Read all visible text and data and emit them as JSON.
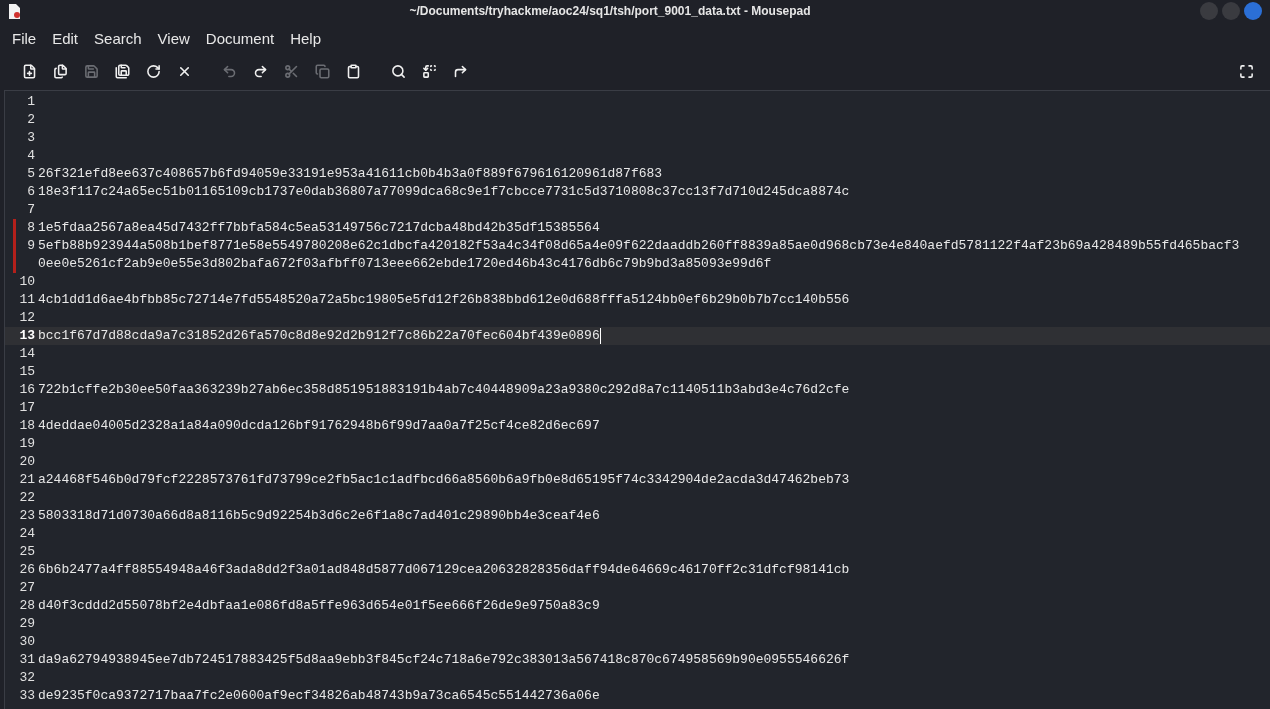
{
  "window": {
    "title": "~/Documents/tryhackme/aoc24/sq1/tsh/port_9001_data.txt - Mousepad"
  },
  "menu": [
    "File",
    "Edit",
    "Search",
    "View",
    "Document",
    "Help"
  ],
  "toolbar": [
    {
      "kind": "new",
      "disabled": false
    },
    {
      "kind": "new-window",
      "disabled": false
    },
    {
      "kind": "save",
      "disabled": true
    },
    {
      "kind": "save-as",
      "disabled": false
    },
    {
      "kind": "reload",
      "disabled": false
    },
    {
      "kind": "close",
      "disabled": false
    },
    {
      "kind": "undo",
      "disabled": true
    },
    {
      "kind": "redo",
      "disabled": false
    },
    {
      "kind": "cut",
      "disabled": true
    },
    {
      "kind": "copy",
      "disabled": true
    },
    {
      "kind": "paste",
      "disabled": false
    },
    {
      "kind": "find",
      "disabled": false
    },
    {
      "kind": "replace",
      "disabled": false
    },
    {
      "kind": "goto",
      "disabled": false
    },
    {
      "kind": "fullscreen",
      "disabled": false
    }
  ],
  "lines": [
    {
      "number": "1",
      "current": false,
      "modified": false
    },
    {
      "number": "2",
      "current": false,
      "modified": false
    },
    {
      "number": "3",
      "current": false,
      "modified": false
    },
    {
      "number": "4",
      "current": false,
      "modified": false
    },
    {
      "number": "5",
      "text": "26f321efd8ee637c408657b6fd94059e33191e953a41611cb0b4b3a0f889f679616120961d87f683",
      "current": false,
      "modified": false
    },
    {
      "number": "6",
      "text": "18e3f117c24a65ec51b01165109cb1737e0dab36807a77099dca68c9e1f7cbcce7731c5d3710808c37cc13f7d710d245dca8874c",
      "current": false,
      "modified": false
    },
    {
      "number": "7",
      "current": false,
      "modified": false
    },
    {
      "number": "8",
      "text": "1e5fdaa2567a8ea45d7432ff7bbfa584c5ea53149756c7217dcba48bd42b35df15385564",
      "current": false,
      "modified": true
    },
    {
      "number": "9",
      "text": "5efb88b923944a508b1bef8771e58e5549780208e62c1dbcfa420182f53a4c34f08d65a4e09f622daaddb260ff8839a85ae0d968cb73e4e840aefd5781122f4af23b69a428489b55fd465bacf30ee0e5261cf2ab9e0e55e3d802bafa672f03afbff0713eee662ebde1720ed46b43c4176db6c79b9bd3a85093e99d6f",
      "current": false,
      "modified": true
    },
    {
      "number": "10",
      "current": false,
      "modified": false
    },
    {
      "number": "11",
      "text": "4cb1dd1d6ae4bfbb85c72714e7fd5548520a72a5bc19805e5fd12f26b838bbd612e0d688fffa5124bb0ef6b29b0b7b7cc140b556",
      "current": false,
      "modified": false
    },
    {
      "number": "12",
      "current": false,
      "modified": false
    },
    {
      "number": "13",
      "text": "bcc1f67d7d88cda9a7c31852d26fa570c8d8e92d2b912f7c86b22a70fec604bf439e0896",
      "current": true,
      "modified": false
    },
    {
      "number": "14",
      "current": false,
      "modified": false
    },
    {
      "number": "15",
      "current": false,
      "modified": false
    },
    {
      "number": "16",
      "text": "722b1cffe2b30ee50faa363239b27ab6ec358d851951883191b4ab7c40448909a23a9380c292d8a7c1140511b3abd3e4c76d2cfe",
      "current": false,
      "modified": false
    },
    {
      "number": "17",
      "current": false,
      "modified": false
    },
    {
      "number": "18",
      "text": "4deddae04005d2328a1a84a090dcda126bf91762948b6f99d7aa0a7f25cf4ce82d6ec697",
      "current": false,
      "modified": false
    },
    {
      "number": "19",
      "current": false,
      "modified": false
    },
    {
      "number": "20",
      "current": false,
      "modified": false
    },
    {
      "number": "21",
      "text": "a24468f546b0d79fcf2228573761fd73799ce2fb5ac1c1adfbcd66a8560b6a9fb0e8d65195f74c3342904de2acda3d47462beb73",
      "current": false,
      "modified": false
    },
    {
      "number": "22",
      "current": false,
      "modified": false
    },
    {
      "number": "23",
      "text": "5803318d71d0730a66d8a8116b5c9d92254b3d6c2e6f1a8c7ad401c29890bb4e3ceaf4e6",
      "current": false,
      "modified": false
    },
    {
      "number": "24",
      "current": false,
      "modified": false
    },
    {
      "number": "25",
      "current": false,
      "modified": false
    },
    {
      "number": "26",
      "text": "6b6b2477a4ff88554948a46f3ada8dd2f3a01ad848d5877d067129cea20632828356daff94de64669c46170ff2c31dfcf98141cb",
      "current": false,
      "modified": false
    },
    {
      "number": "27",
      "current": false,
      "modified": false
    },
    {
      "number": "28",
      "text": "d40f3cddd2d55078bf2e4dbfaa1e086fd8a5ffe963d654e01f5ee666f26de9e9750a83c9",
      "current": false,
      "modified": false
    },
    {
      "number": "29",
      "current": false,
      "modified": false
    },
    {
      "number": "30",
      "current": false,
      "modified": false
    },
    {
      "number": "31",
      "text": "da9a62794938945ee7db724517883425f5d8aa9ebb3f845cf24c718a6e792c383013a567418c870c674958569b90e0955546626f",
      "current": false,
      "modified": false
    },
    {
      "number": "32",
      "current": false,
      "modified": false
    },
    {
      "number": "33",
      "text": "de9235f0ca9372717baa7fc2e0600af9ecf34826ab48743b9a73ca6545c551442736a06e",
      "current": false,
      "modified": false
    }
  ]
}
